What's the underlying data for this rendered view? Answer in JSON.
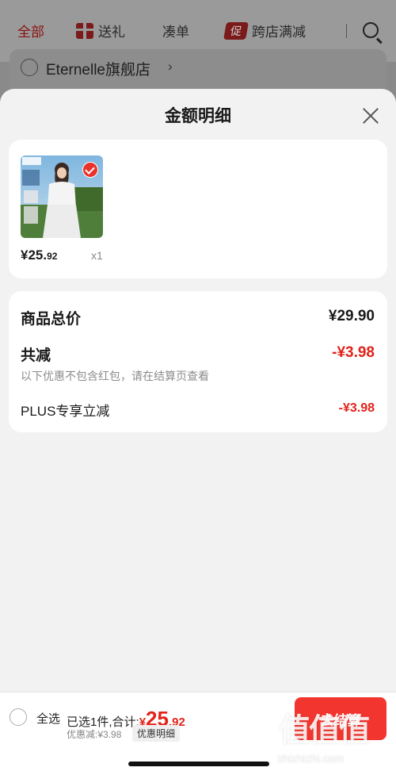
{
  "background": {
    "tabs": [
      {
        "label": "全部",
        "active": true
      },
      {
        "label": "送礼",
        "icon": "gift-icon"
      },
      {
        "label": "凑单"
      },
      {
        "label": "跨店满减",
        "badge": "促"
      }
    ],
    "shop_name": "Eternelle旗舰店",
    "shop_chevron": "›"
  },
  "sheet": {
    "title": "金额明细",
    "product": {
      "price_int": "¥25.",
      "price_dec": "92",
      "qty": "x1",
      "selected": true
    },
    "summary": {
      "total_label": "商品总价",
      "total_value": "¥29.90",
      "reduce_label": "共减",
      "reduce_value": "-¥3.98",
      "note": "以下优惠不包含红包，请在结算页查看",
      "plus_label": "PLUS专享立减",
      "plus_value": "-¥3.98"
    }
  },
  "bottom": {
    "select_all": "全选",
    "selected_text": "已选1件,合计:",
    "total_currency": "¥",
    "total_int": "25",
    "total_dec": ".92",
    "discount_text": "优惠减:¥3.98",
    "detail_button": "优惠明细",
    "checkout_button": "去结算"
  },
  "watermark": {
    "logo": "值值值",
    "url": "zhizhizhi.com"
  },
  "colors": {
    "accent": "#e2231a",
    "checkout": "#f2362f"
  }
}
